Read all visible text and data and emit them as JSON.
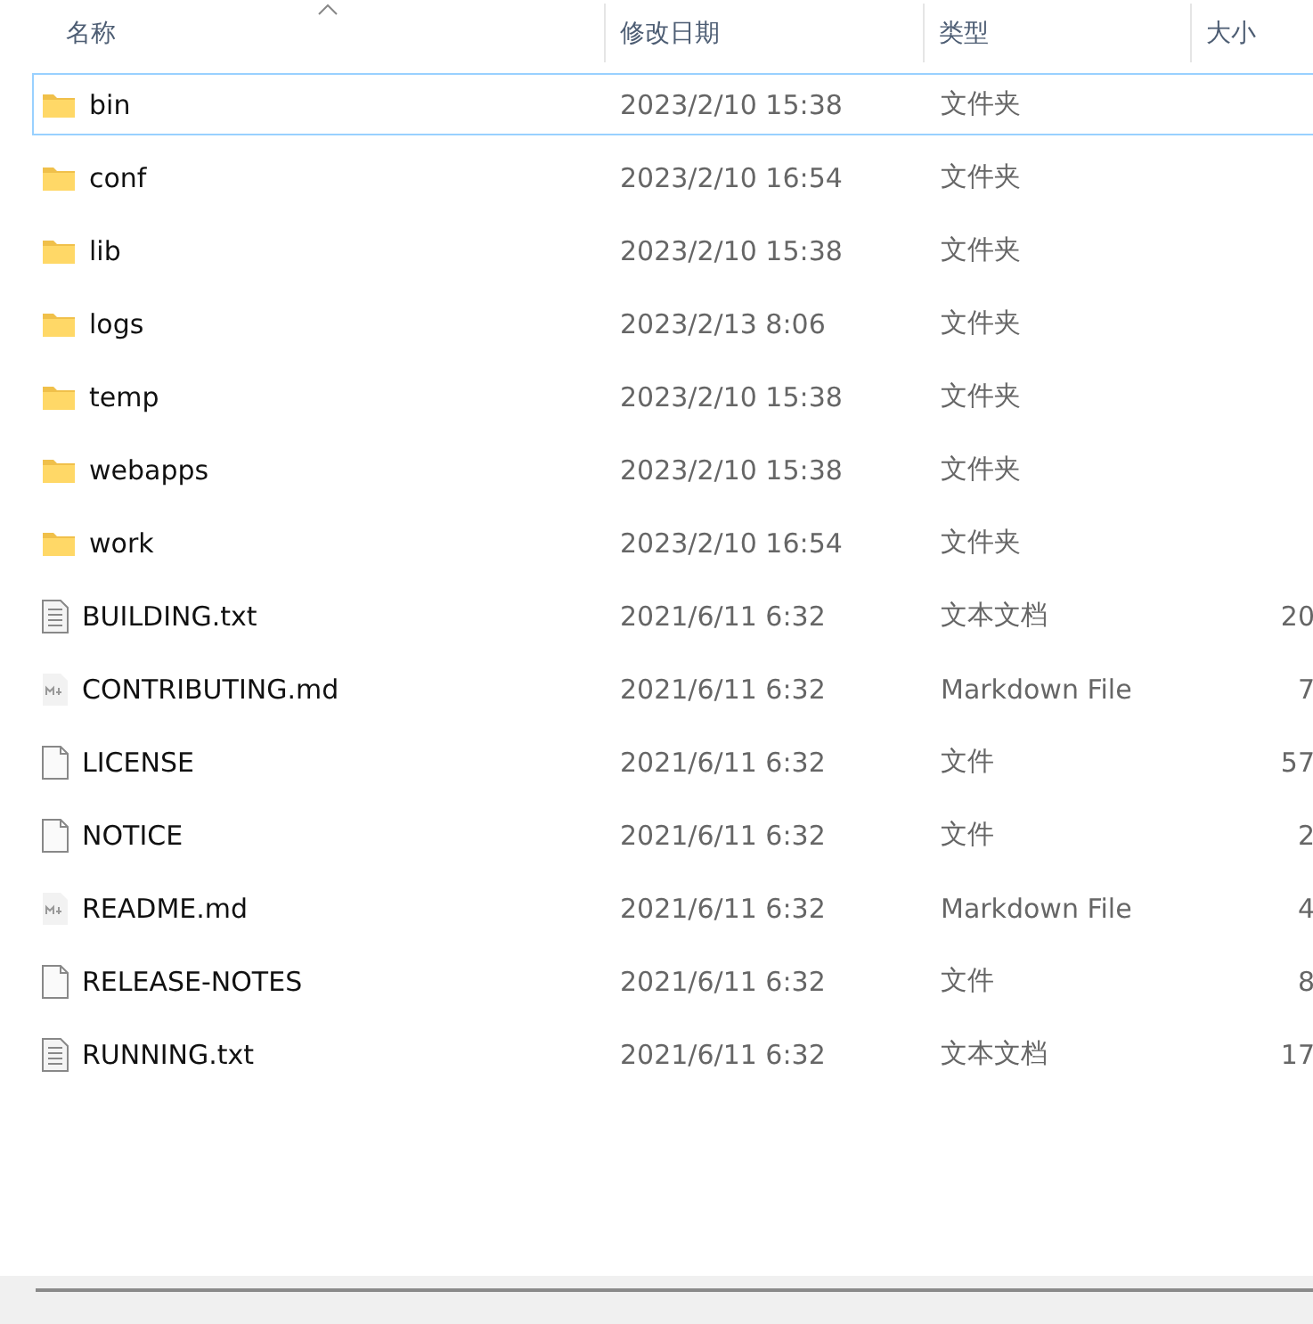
{
  "columns": [
    {
      "label": "名称",
      "sorted": true
    },
    {
      "label": "修改日期",
      "sorted": false
    },
    {
      "label": "类型",
      "sorted": false
    },
    {
      "label": "大小",
      "sorted": false
    }
  ],
  "rows": [
    {
      "kind": "folder",
      "name": "bin",
      "date": "2023/2/10 15:38",
      "type": "文件夹",
      "focused": true
    },
    {
      "kind": "folder",
      "name": "conf",
      "date": "2023/2/10 16:54",
      "type": "文件夹",
      "focused": false
    },
    {
      "kind": "folder",
      "name": "lib",
      "date": "2023/2/10 15:38",
      "type": "文件夹",
      "focused": false
    },
    {
      "kind": "folder",
      "name": "logs",
      "date": "2023/2/13 8:06",
      "type": "文件夹",
      "focused": false
    },
    {
      "kind": "folder",
      "name": "temp",
      "date": "2023/2/10 15:38",
      "type": "文件夹",
      "focused": false
    },
    {
      "kind": "folder",
      "name": "webapps",
      "date": "2023/2/10 15:38",
      "type": "文件夹",
      "focused": false
    },
    {
      "kind": "folder",
      "name": "work",
      "date": "2023/2/10 16:54",
      "type": "文件夹",
      "focused": false
    },
    {
      "kind": "text",
      "name": "BUILDING.txt",
      "date": "2021/6/11 6:32",
      "type": "文本文档",
      "size": "20",
      "focused": false
    },
    {
      "kind": "markdown",
      "name": "CONTRIBUTING.md",
      "date": "2021/6/11 6:32",
      "type": "Markdown File",
      "size": "7",
      "focused": false
    },
    {
      "kind": "blank",
      "name": "LICENSE",
      "date": "2021/6/11 6:32",
      "type": "文件",
      "size": "57",
      "focused": false
    },
    {
      "kind": "blank",
      "name": "NOTICE",
      "date": "2021/6/11 6:32",
      "type": "文件",
      "size": "2",
      "focused": false
    },
    {
      "kind": "markdown",
      "name": "README.md",
      "date": "2021/6/11 6:32",
      "type": "Markdown File",
      "size": "4",
      "focused": false
    },
    {
      "kind": "blank",
      "name": "RELEASE-NOTES",
      "date": "2021/6/11 6:32",
      "type": "文件",
      "size": "8",
      "focused": false
    },
    {
      "kind": "text",
      "name": "RUNNING.txt",
      "date": "2021/6/11 6:32",
      "type": "文本文档",
      "size": "17",
      "focused": false
    }
  ]
}
